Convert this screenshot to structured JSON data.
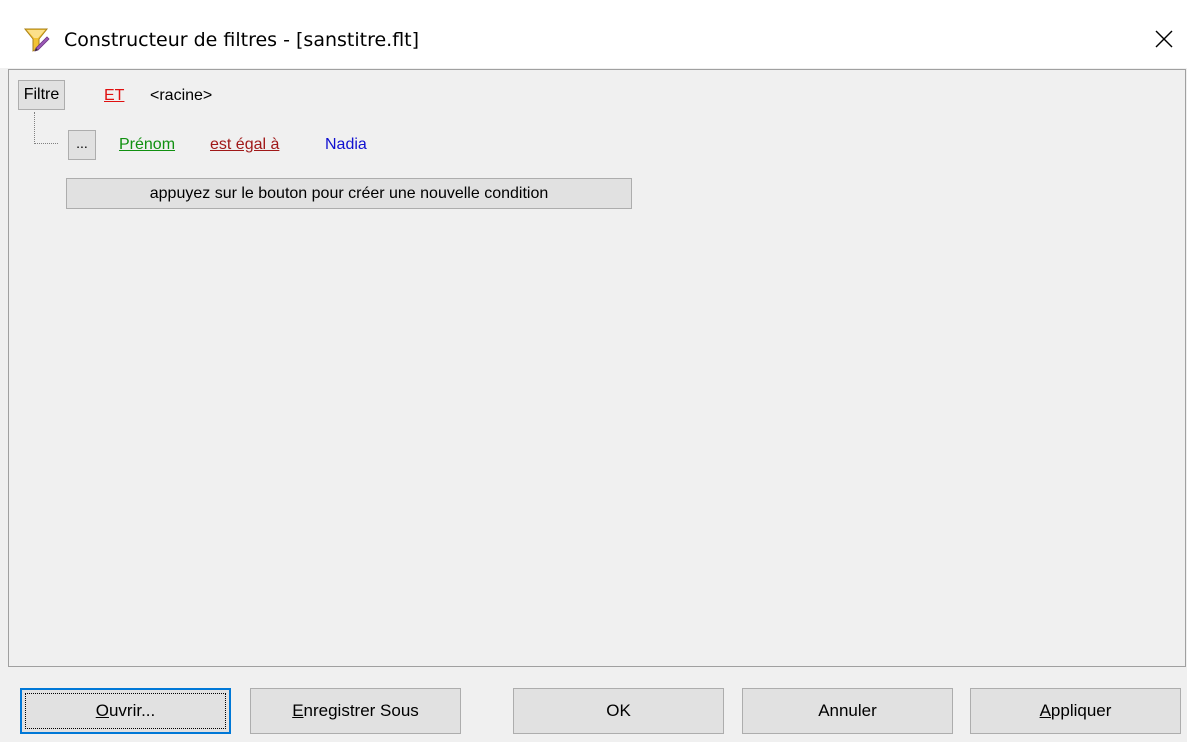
{
  "window": {
    "title": "Constructeur de filtres - [sanstitre.flt]",
    "icon": "filter-funnel-icon",
    "close_icon": "close-icon"
  },
  "filter": {
    "filter_button_label": "Filtre",
    "group_operator": "ET",
    "root_label": "<racine>",
    "conditions": [
      {
        "menu_button_label": "...",
        "field": "Prénom",
        "operator": "est égal à",
        "value": "Nadia"
      }
    ],
    "add_condition_label": "appuyez sur le bouton pour créer une nouvelle condition"
  },
  "footer": {
    "open": {
      "mnemonic": "O",
      "rest": "uvrir..."
    },
    "save_as": {
      "mnemonic": "E",
      "rest": "nregistrer Sous"
    },
    "ok_label": "OK",
    "cancel_label": "Annuler",
    "apply": {
      "mnemonic": "A",
      "rest": "ppliquer"
    }
  },
  "colors": {
    "group_operator": "#e01010",
    "field": "#109010",
    "operator": "#a01818",
    "value": "#1010d0",
    "default_button_border": "#0078d7"
  }
}
